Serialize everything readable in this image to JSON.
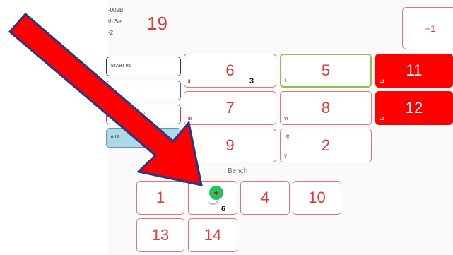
{
  "header": {
    "line1": "-002B",
    "line2": "th Set",
    "line3": "-2",
    "score": "19",
    "plus_one": "+1"
  },
  "side_buttons": [
    {
      "label": "START 0:0",
      "variant": "plain"
    },
    {
      "label": "",
      "variant": "blue-outline"
    },
    {
      "label": "UB SCORE 18:19",
      "variant": "red"
    },
    {
      "label": "0:19",
      "variant": "lightblue"
    }
  ],
  "court": [
    {
      "number": "6",
      "roman": "II",
      "count": "3"
    },
    {
      "number": "5",
      "roman": "I",
      "selected": true
    },
    {
      "number": "11",
      "roman": "L1",
      "libero": true
    },
    {
      "number": "7",
      "roman": "III"
    },
    {
      "number": "8",
      "roman": "VI"
    },
    {
      "number": "12",
      "roman": "L2",
      "libero": true
    },
    {
      "number": "9",
      "roman": ""
    },
    {
      "number": "2",
      "roman": "V",
      "sup": "C"
    }
  ],
  "bench": {
    "label": "Bench",
    "players": [
      "1",
      "",
      "4",
      "10",
      "13",
      "14"
    ],
    "badge": "+",
    "badge_count": "6"
  },
  "colors": {
    "accent_red": "#e53935",
    "libero_red": "#ff0000",
    "selected_green": "#8bc34a",
    "arrow_red": "#ff0000",
    "arrow_outline": "#1e3a8a"
  }
}
